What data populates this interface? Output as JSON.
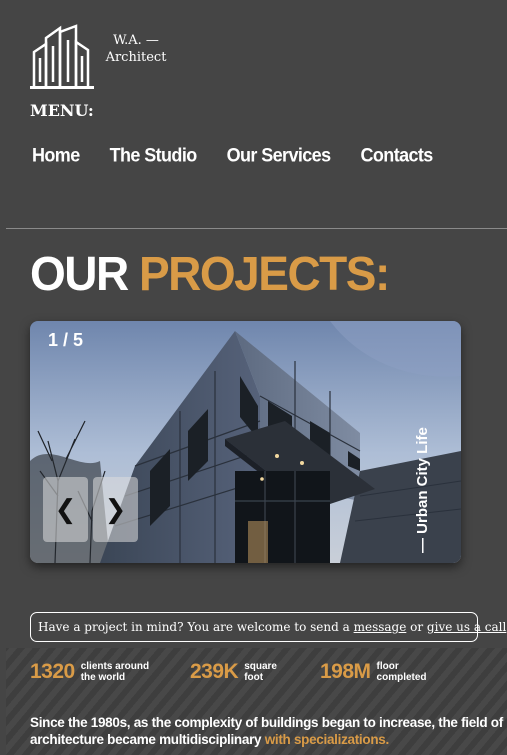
{
  "brand": {
    "line1": "W.A. —",
    "line2": "Architect"
  },
  "menu": {
    "label": "MENU:",
    "items": [
      "Home",
      "The Studio",
      "Our Services",
      "Contacts"
    ]
  },
  "heading": {
    "part1": "OUR ",
    "part2": "PROJECTS:"
  },
  "slider": {
    "counter": "1 / 5",
    "caption": "— Urban City Life",
    "prev_label": "❮",
    "next_label": "❯"
  },
  "cta": {
    "prefix": "Have a project in mind? You are welcome to send a ",
    "link1": "message",
    "middle": " or ",
    "link2": "give us a call",
    "suffix": "."
  },
  "stats": [
    {
      "value": "1320",
      "label1": "clients around",
      "label2": "the world"
    },
    {
      "value": "239K",
      "label1": "square",
      "label2": "foot"
    },
    {
      "value": "198M",
      "label1": "floor",
      "label2": "completed"
    }
  ],
  "about": {
    "text": "Since the 1980s, as the complexity of buildings began to increase, the field of architecture became multidisciplinary ",
    "accent": "with specializations."
  },
  "colors": {
    "background": "#454545",
    "accent": "#d99b47",
    "text": "#ffffff"
  }
}
